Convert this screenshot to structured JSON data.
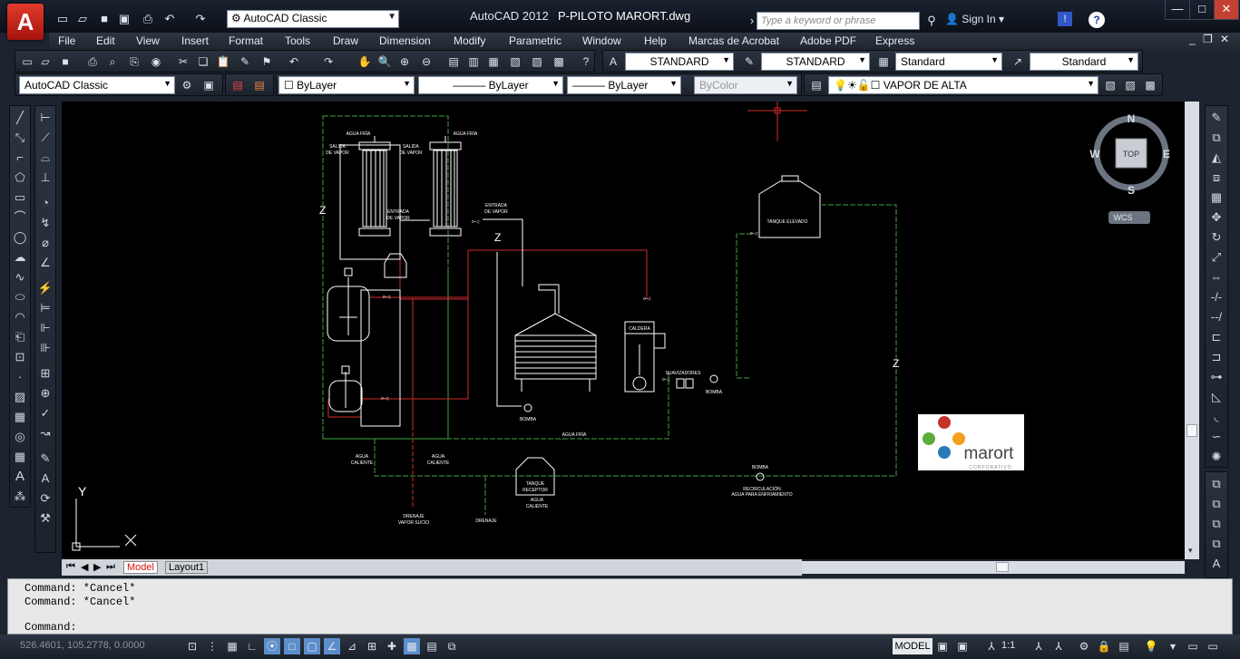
{
  "app": {
    "logo": "A",
    "name": "AutoCAD 2012",
    "file": "P-PILOTO MARORT.dwg",
    "workspace": "AutoCAD Classic",
    "search_placeholder": "Type a keyword or phrase",
    "sign_in": "Sign In",
    "help_icon": "?"
  },
  "menus": [
    "File",
    "Edit",
    "View",
    "Insert",
    "Format",
    "Tools",
    "Draw",
    "Dimension",
    "Modify",
    "Parametric",
    "Window",
    "Help",
    "Marcas de Acrobat",
    "Adobe PDF",
    "Express"
  ],
  "styles": {
    "text_style": "STANDARD",
    "dim_style": "STANDARD",
    "table_style": "Standard",
    "mleader_style": "Standard"
  },
  "props": {
    "workspace2": "AutoCAD Classic",
    "color": "ByLayer",
    "linetype": "ByLayer",
    "lineweight": "ByLayer",
    "plotstyle": "ByColor",
    "layer": "VAPOR DE ALTA"
  },
  "viewcube": {
    "n": "N",
    "s": "S",
    "e": "E",
    "w": "W",
    "top": "TOP",
    "wcs": "WCS"
  },
  "drawing": {
    "agua_fria_1": "AGUA FRÍA",
    "agua_fria_2": "AGUA FRÍA",
    "salida_vapor_1a": "SALIDA",
    "salida_vapor_1b": "DE VAPOR",
    "salida_vapor_2a": "SALIDA",
    "salida_vapor_2b": "DE VAPOR",
    "entrada_vapor_1a": "ENTRADA",
    "entrada_vapor_1b": "DE VAPOR",
    "entrada_vapor_2a": "ENTRADA",
    "entrada_vapor_2b": "DE VAPOR",
    "tanque_elevado": "TANQUE ELEVADO",
    "caldera": "CALDERA",
    "suavizadores": "SUAVIZADORES",
    "bomba_1": "BOMBA",
    "bomba_2": "BOMBA",
    "bomba_3": "BOMBA",
    "agua_fria_line": "AGUA FRÍA",
    "agua_caliente_1a": "AGUA",
    "agua_caliente_1b": "CALIENTE",
    "agua_caliente_2a": "AGUA",
    "agua_caliente_2b": "CALIENTE",
    "tanque_receptor_a": "TANQUE",
    "tanque_receptor_b": "RECEPTOR",
    "agua_caliente_3a": "AGUA",
    "agua_caliente_3b": "CALIENTE",
    "drenaje_vapor_a": "DRENAJE",
    "drenaje_vapor_b": "VAPOR SUCIO",
    "drenaje": "DRENAJE",
    "recirculacion_a": "RECIRCULACIÓN",
    "recirculacion_b": "AGUA PARA ENFRIAMIENTO",
    "z1": "Z",
    "z2": "Z",
    "z3": "Z",
    "ucs_y": "Y",
    "logo_name": "marort",
    "logo_sub": "CORPORATIVO"
  },
  "tabs": {
    "model": "Model",
    "layout1": "Layout1"
  },
  "command": {
    "line1": "Command: *Cancel*",
    "line2": "Command: *Cancel*",
    "prompt": "Command:"
  },
  "status": {
    "coords": "526.4601, 105.2778, 0.0000",
    "model": "MODEL",
    "scale": "1:1"
  }
}
